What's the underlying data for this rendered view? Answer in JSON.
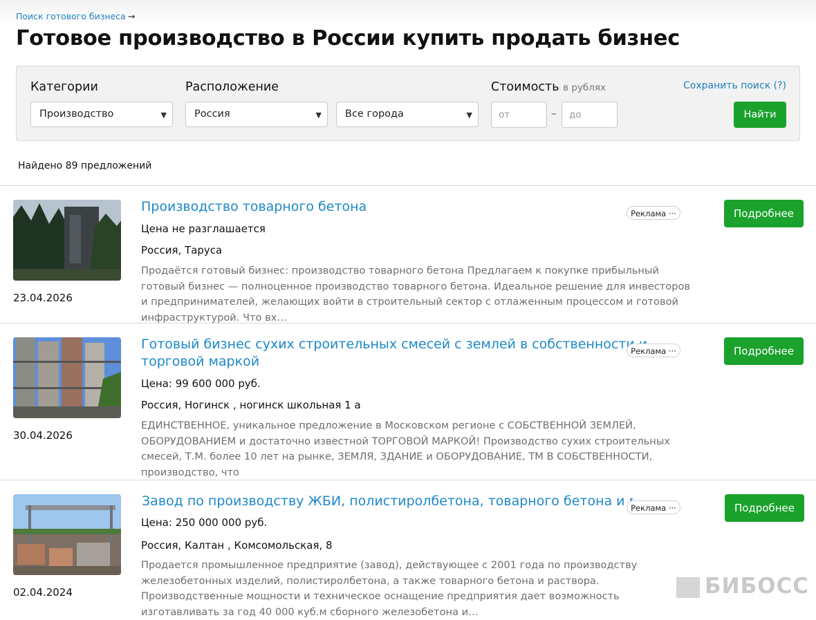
{
  "breadcrumb": {
    "label": "Поиск готового бизнеса",
    "arrow": "→"
  },
  "page_title": "Готовое производство в России купить продать бизнес",
  "filters": {
    "categories_label": "Категории",
    "category_value": "Производство",
    "location_label": "Расположение",
    "country_value": "Россия",
    "city_value": "Все города",
    "price_label": "Стоимость",
    "price_unit": "в рублях",
    "price_from_placeholder": "от",
    "price_separator": "–",
    "price_to_placeholder": "до",
    "save_search": "Сохранить поиск (?)",
    "find_button": "Найти"
  },
  "results_count": "Найдено 89 предложений",
  "listings": [
    {
      "title": "Производство товарного бетона",
      "price": "Цена не разглашается",
      "location": "Россия, Таруса",
      "description": "Продаётся готовый бизнес: производство товарного бетона Предлагаем к покупке прибыльный готовый бизнес — полноценное производство товарного бетона. Идеальное решение для инвесторов и предпринимателей, желающих войти в строительный сектор с отлаженным процессом и готовой инфраструктурой. Что вх…",
      "date": "23.04.2026",
      "ad_label": "Реклама",
      "more_button": "Подробнее"
    },
    {
      "title": "Готовый бизнес сухих строительных смесей с землей в собственности и торговой маркой",
      "price": "Цена: 99 600 000 руб.",
      "location": "Россия, Ногинск , ногинск школьная 1 а",
      "description": "ЕДИНСТВЕННОЕ, уникальное предложение в Московском регионе с СОБСТВЕННОЙ ЗЕМЛЕЙ, ОБОРУДОВАНИЕМ и достаточно известной ТОРГОВОЙ МАРКОЙ! Производство сухих строительных смесей, Т.М. более 10 лет на рынке, ЗЕМЛЯ, ЗДАНИЕ и ОБОРУДОВАНИЕ, ТМ В СОБСТВЕННОСТИ, производство, что",
      "date": "30.04.2026",
      "ad_label": "Реклама",
      "more_button": "Подробнее"
    },
    {
      "title": "Завод по производству ЖБИ, полистиролбетона, товарного бетона и раствора",
      "price": "Цена: 250 000 000 руб.",
      "location": "Россия, Калтан , Комсомольская, 8",
      "description": "Продается промышленное предприятие (завод), действующее с 2001 года по производству железобетонных изделий, полистиролбетона, а также товарного бетона и раствора. Производственные мощности и техническое оснащение предприятия дает возможность изготавливать за год 40 000 куб.м сборного железобетона и…",
      "date": "02.04.2024",
      "ad_label": "Реклама",
      "more_button": "Подробнее"
    }
  ],
  "watermark": "БИБОСС",
  "colors": {
    "accent_green": "#1ba22d",
    "link_blue": "#1e88c8"
  }
}
